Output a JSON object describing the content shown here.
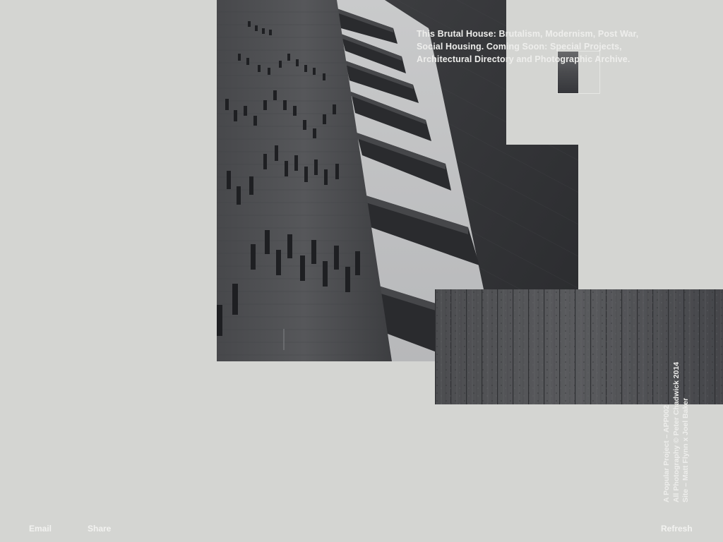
{
  "headline": "This Brutal House: Brutalism, Modernism, Post War, Social Housing. Coming Soon: Special Projects, Architectural Directory and Photographic Archive.",
  "credits": {
    "line1": "A Popular Project – APP002",
    "line2": "All Photography © Peter Chadwick 2014",
    "line3": "Site – Matt Flynn x Joel Baker"
  },
  "footer": {
    "email_label": "Email",
    "share_label": "Share",
    "refresh_label": "Refresh"
  },
  "images": {
    "main": "brutalist-tower-photo",
    "texture": "board-marked-concrete-photo",
    "fragment": "tower-detail-photo"
  },
  "colors": {
    "background": "#d4d5d2",
    "text": "#eeeeec",
    "concrete_dark": "#3a3b3e"
  }
}
